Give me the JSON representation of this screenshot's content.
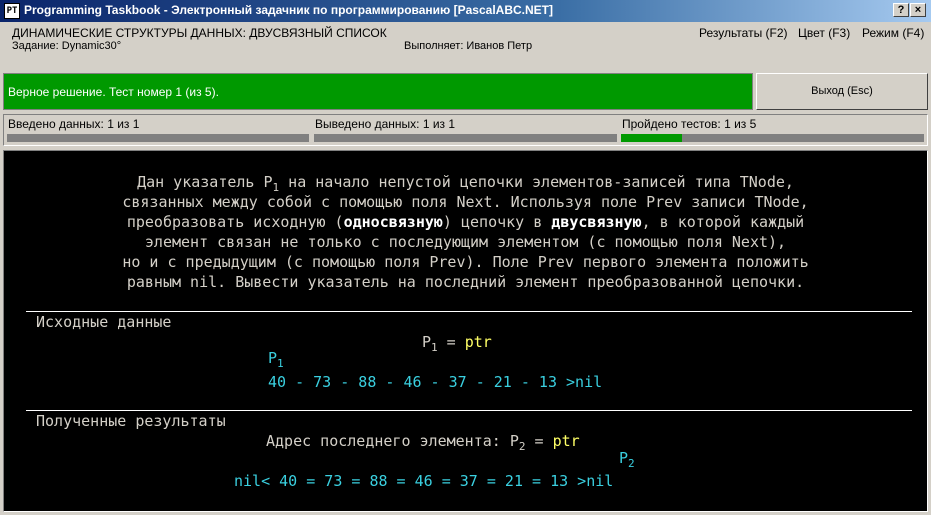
{
  "window": {
    "title": "Programming Taskbook - Электронный задачник по программированию [PascalABC.NET]",
    "icon_text": "PT",
    "buttons": {
      "help": "?",
      "close": "×"
    }
  },
  "header": {
    "topic": "ДИНАМИЧЕСКИЕ СТРУКТУРЫ ДАННЫХ: ДВУСВЯЗНЫЙ СПИСОК",
    "task": "Задание: Dynamic30°",
    "performer": "Выполняет: Иванов Петр",
    "menu": {
      "results": "Результаты (F2)",
      "color": "Цвет (F3)",
      "mode": "Режим (F4)"
    }
  },
  "status": {
    "message": "Верное решение. Тест номер 1 (из 5).",
    "color": "#009900",
    "exit_label": "Выход (Esc)"
  },
  "progress": {
    "input": {
      "label": "Введено данных: 1 из 1"
    },
    "output": {
      "label": "Выведено данных: 1 из 1"
    },
    "tests": {
      "label": "Пройдено тестов: 1 из 5",
      "fraction": 0.2,
      "color": "#009900"
    }
  },
  "task_text": {
    "line1": "Дан указатель P",
    "line1_sub": "1",
    "line1_rest": " на начало непустой цепочки элементов-записей типа TNode,",
    "line2": "связанных между собой с помощью поля Next. Используя поле Prev записи TNode,",
    "line3_a": "преобразовать исходную (",
    "line3_b": "односвязную",
    "line3_c": ") цепочку в ",
    "line3_d": "двусвязную",
    "line3_e": ", в которой каждый",
    "line4": "элемент связан не только с последующим элементом (с помощью поля Next),",
    "line5": "но и с предыдущим (с помощью поля Prev). Поле Prev первого элемента положить",
    "line6": "равным nil. Вывести указатель на последний элемент преобразованной цепочки."
  },
  "input_section": {
    "title": "Исходные данные",
    "ptr_label": "P",
    "ptr_sub": "1",
    "ptr_eq": " = ",
    "ptr_value": "ptr",
    "list_marker": "P",
    "list_marker_sub": "1",
    "chain": "40 - 73 - 88 - 46 - 37 - 21 - 13 >nil"
  },
  "output_section": {
    "title": "Полученные результаты",
    "addr_label": "Адрес последнего элемента: P",
    "addr_sub": "2",
    "addr_eq": " = ",
    "addr_value": "ptr",
    "list_marker": "P",
    "list_marker_sub": "2",
    "chain": "nil< 40 = 73 = 88 = 46 = 37 = 21 = 13 >nil"
  },
  "colors": {
    "text": "#d4d0c8",
    "value": "#3ad0e0",
    "pointer": "#ffff66",
    "background": "#000000"
  }
}
